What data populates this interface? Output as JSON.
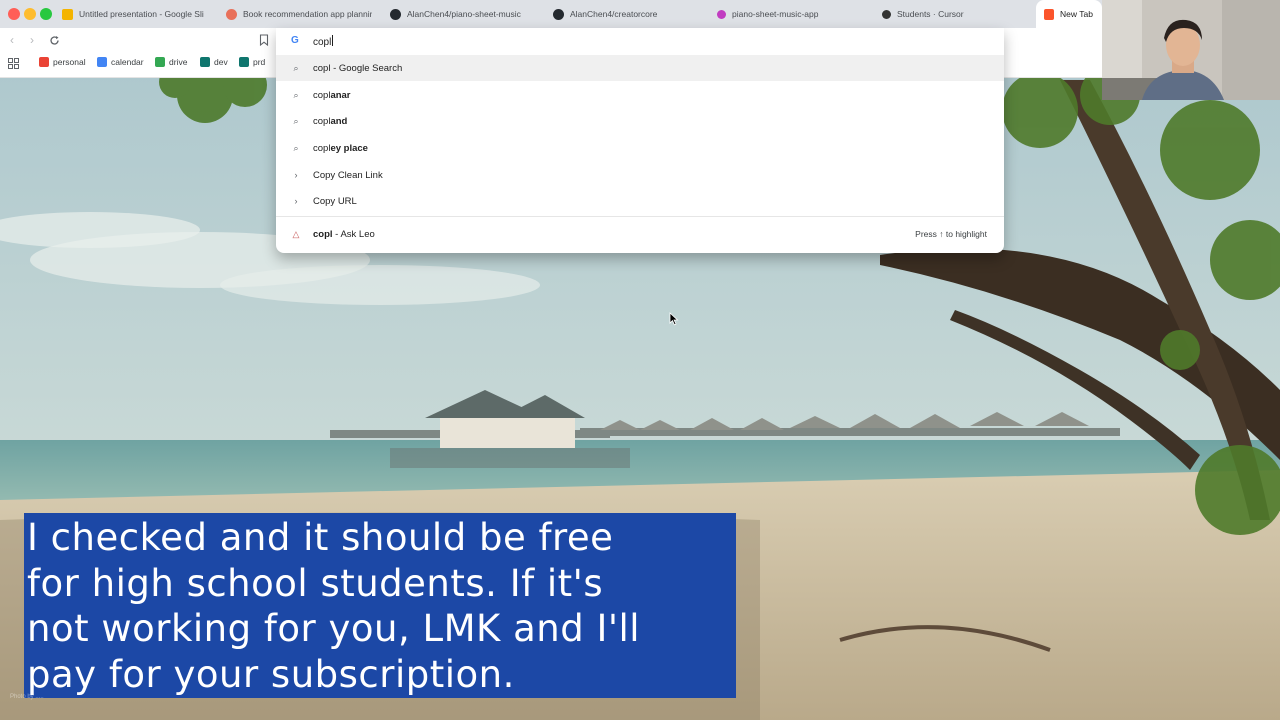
{
  "browser": {
    "tabs": [
      {
        "label": "Untitled presentation - Google Sli",
        "icon": "google-slides-icon",
        "color": "#f4b400"
      },
      {
        "label": "Book recommendation app plannin",
        "icon": "app-icon",
        "color": "#e8705a"
      },
      {
        "label": "AlanChen4/piano-sheet-music",
        "icon": "github-icon",
        "color": "#24292f"
      },
      {
        "label": "AlanChen4/creatorcore",
        "icon": "github-icon",
        "color": "#24292f"
      },
      {
        "label": "piano-sheet-music-app",
        "icon": "sparkle-icon",
        "color": "#c13cc1"
      },
      {
        "label": "Students · Cursor",
        "icon": "cursor-icon",
        "color": "#333333"
      },
      {
        "label": "New Tab",
        "icon": "brave-icon",
        "color": "#fb542b"
      }
    ],
    "bookmarks": [
      {
        "label": "personal",
        "icon": "gmail-icon",
        "color": "#ea4335"
      },
      {
        "label": "calendar",
        "icon": "calendar-icon",
        "color": "#4285f4"
      },
      {
        "label": "drive",
        "icon": "drive-icon",
        "color": "#34a853"
      },
      {
        "label": "dev",
        "icon": "dev-icon",
        "color": "#0f766e"
      },
      {
        "label": "prd",
        "icon": "prd-icon",
        "color": "#0f766e"
      }
    ]
  },
  "omnibox": {
    "query": "copl",
    "suggestions": [
      {
        "icon": "search-icon",
        "typed": "copl",
        "rest": " - Google Search",
        "rest_bold": false
      },
      {
        "icon": "search-icon",
        "typed": "copl",
        "rest": "anar",
        "rest_bold": true
      },
      {
        "icon": "search-icon",
        "typed": "copl",
        "rest": "and",
        "rest_bold": true
      },
      {
        "icon": "search-icon",
        "typed": "copl",
        "rest": "ey place",
        "rest_bold": true
      },
      {
        "icon": "chevron-right-icon",
        "typed": "",
        "rest": "Copy Clean Link",
        "rest_bold": true
      },
      {
        "icon": "chevron-right-icon",
        "typed": "",
        "rest": "Copy URL",
        "rest_bold": true
      }
    ],
    "leo": {
      "query": "copl",
      "label": " - Ask Leo",
      "hint": "Press ↑ to highlight"
    }
  },
  "caption": {
    "lines": [
      "I checked and it should be free",
      "for high school students. If it's",
      "not working for you, LMK and I'll",
      "pay for your subscription."
    ],
    "background": "#1c48a6"
  },
  "credit": "Photo by ....."
}
